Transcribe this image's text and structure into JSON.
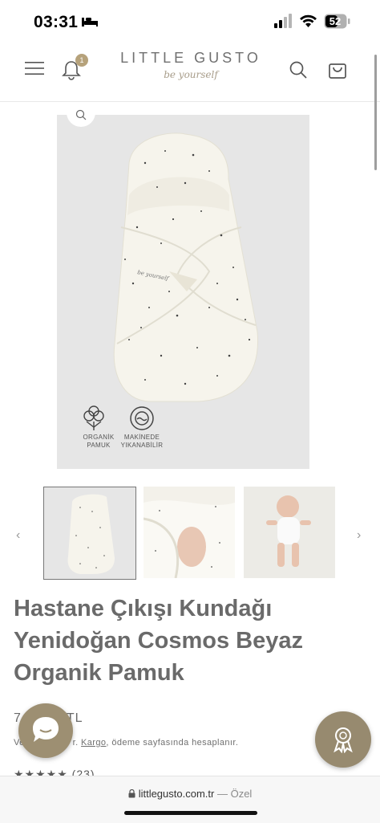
{
  "status_bar": {
    "time": "03:31",
    "battery": "52",
    "icons": [
      "bed-icon",
      "signal-icon",
      "wifi-icon",
      "battery-icon"
    ]
  },
  "header": {
    "brand": "LITTLE GUSTO",
    "tagline": "be yourself",
    "notification_count": "1",
    "icons": [
      "menu-icon",
      "bell-icon",
      "search-icon",
      "shopping-bag-icon"
    ]
  },
  "gallery": {
    "features": [
      {
        "icon": "cotton-icon",
        "label": "ORGANİK PAMUK"
      },
      {
        "icon": "washing-machine-icon",
        "label": "MAKİNEDE YIKANABİLİR"
      }
    ],
    "thumbnails": [
      "thumbnail-swaddle-front",
      "thumbnail-swaddle-detail",
      "thumbnail-baby-bodysuit"
    ],
    "prev_arrow": "‹",
    "next_arrow": "›"
  },
  "product": {
    "title_lines": [
      "Hastane Çıkışı Kundağı",
      "Yenidoğan Cosmos Beyaz",
      "Organik Pamuk"
    ],
    "price": "7",
    "price_suffix": "TL",
    "shipping_prefix": "Ve",
    "shipping_mid": "r.",
    "shipping_link": "Kargo",
    "shipping_rest": ", ödeme sayfasında hesaplanır.",
    "stars": "★★★★★",
    "review_count": "(23)"
  },
  "browser": {
    "url": "littlegusto.com.tr",
    "mode": "— Özel"
  },
  "colors": {
    "brand": "#9d8f72",
    "badge": "#b6a27b",
    "image_bg": "#e6e6e6"
  }
}
